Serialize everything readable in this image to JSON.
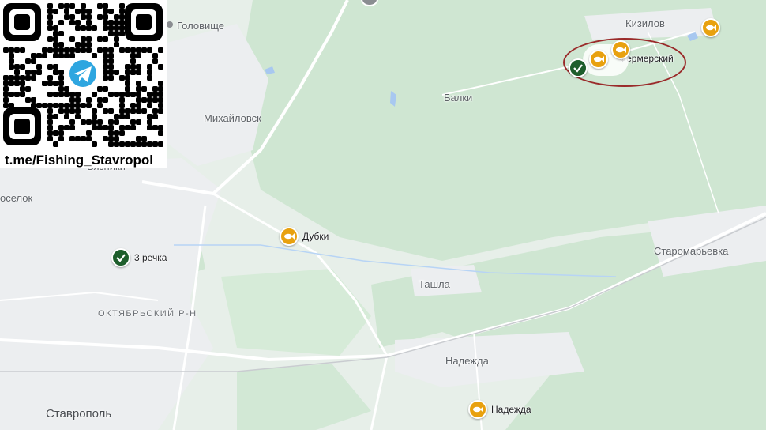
{
  "places": {
    "golovishche": "Головище",
    "kizilov": "Кизилов",
    "mikhaylovsk": "Михайловск",
    "balki": "Балки",
    "vyazniki": "Вязники",
    "poselok": "оселок",
    "staromaryevka": "Старомарьевка",
    "tashla": "Ташла",
    "oktyabrsky": "ОКТЯБРЬСКИЙ Р-Н",
    "nadezhda_town": "Надежда",
    "stavropol": "Ставрополь"
  },
  "markers": {
    "fermersky": {
      "label": "Фермерский",
      "icon": "fish-icon"
    },
    "dubki": {
      "label": "Дубки",
      "icon": "fish-icon"
    },
    "tri_rechka": {
      "label": "3 речка",
      "icon": "checkmark-icon"
    },
    "nadezhda": {
      "label": "Надежда",
      "icon": "fish-icon"
    }
  },
  "qr": {
    "caption": "t.me/Fishing_Stavropol",
    "logo_icon": "telegram-icon"
  },
  "colors": {
    "forest": "#cfe6d2",
    "urban": "#eceef0",
    "road": "#ffffff",
    "water": "#a8c8f0",
    "fish_marker": "#e8a10f",
    "check_marker": "#1e5e2c",
    "highlight": "#9a2a2a"
  }
}
